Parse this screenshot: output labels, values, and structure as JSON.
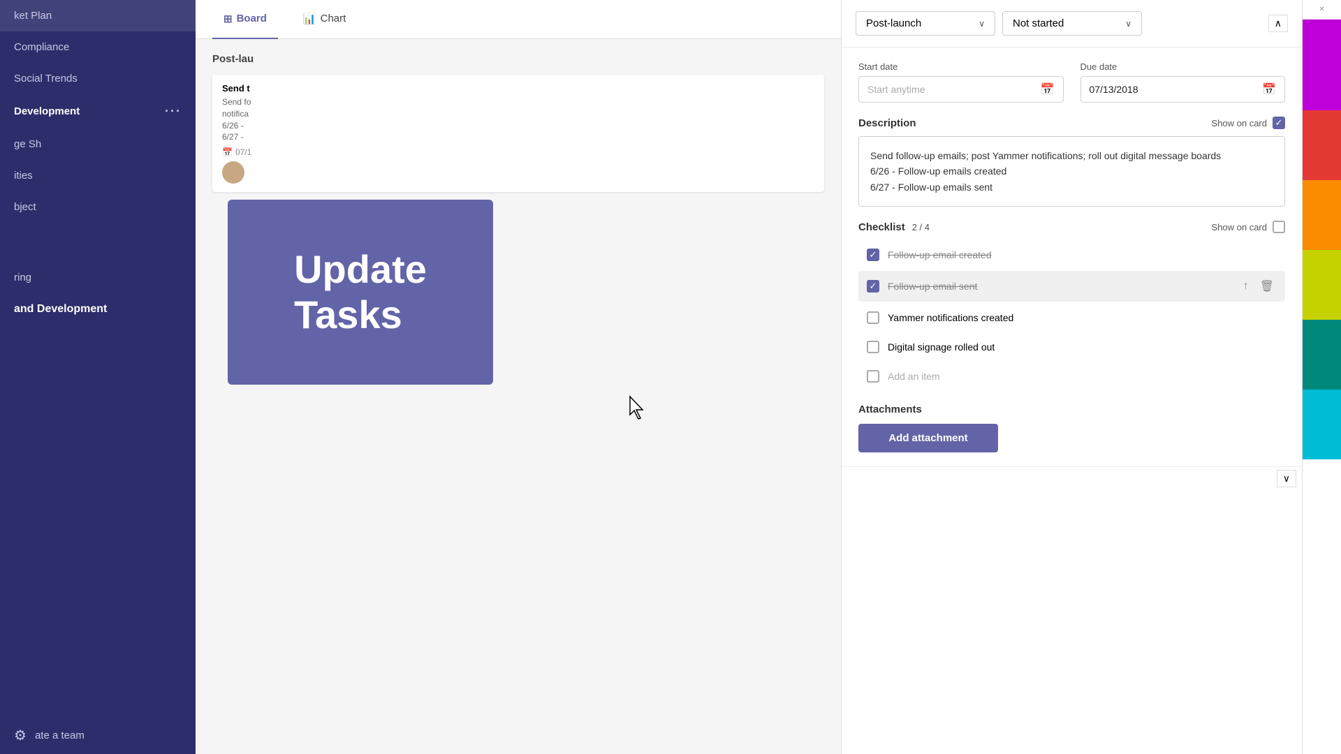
{
  "sidebar": {
    "items": [
      {
        "id": "market-plan",
        "label": "ket Plan",
        "active": false
      },
      {
        "id": "compliance",
        "label": "Compliance",
        "active": false
      },
      {
        "id": "social-trends",
        "label": "Social Trends",
        "active": false
      },
      {
        "id": "development",
        "label": "Development",
        "dots": "···",
        "active": true
      },
      {
        "id": "ge-sh",
        "label": "ge Sh",
        "active": false
      },
      {
        "id": "ities",
        "label": "ities",
        "active": false
      },
      {
        "id": "bject",
        "label": "bject",
        "active": false
      },
      {
        "id": "blank1",
        "label": "",
        "active": false
      },
      {
        "id": "blank2",
        "label": "",
        "active": false
      },
      {
        "id": "ring",
        "label": "ring",
        "active": false
      },
      {
        "id": "and-development",
        "label": "and Development",
        "bold": true,
        "active": false
      },
      {
        "id": "ate-a-team",
        "label": "ate a team",
        "active": false
      }
    ],
    "create_team_label": "ate a team",
    "gear_label": "⚙"
  },
  "tabs": [
    {
      "id": "board",
      "label": "Board",
      "icon": "⊞",
      "active": true
    },
    {
      "id": "chart",
      "label": "Chart",
      "icon": "📊",
      "active": false
    }
  ],
  "board": {
    "section_title": "Post-lau",
    "card": {
      "title": "Send t",
      "description": "Send fo\nnotifica\n6/26 -\n6/27 -",
      "date": "07/1"
    }
  },
  "overlay": {
    "line1": "Update",
    "line2": "Tasks"
  },
  "detail_panel": {
    "bucket_dropdown": "Post-launch",
    "status_dropdown": "Not started",
    "start_date_label": "Start date",
    "start_date_placeholder": "Start anytime",
    "due_date_label": "Due date",
    "due_date_value": "07/13/2018",
    "description_label": "Description",
    "show_on_card_label": "Show on card",
    "description_text": "Send follow-up emails; post Yammer notifications; roll out digital message boards\n6/26 - Follow-up emails created\n6/27 - Follow-up emails sent",
    "checklist_label": "Checklist",
    "checklist_count": "2 / 4",
    "checklist_items": [
      {
        "id": 1,
        "text": "Follow-up email created",
        "checked": true,
        "strikethrough": true
      },
      {
        "id": 2,
        "text": "Follow-up email sent",
        "checked": true,
        "strikethrough": true,
        "active": true
      },
      {
        "id": 3,
        "text": "Yammer notifications created",
        "checked": false,
        "strikethrough": false
      },
      {
        "id": 4,
        "text": "Digital signage rolled out",
        "checked": false,
        "strikethrough": false
      }
    ],
    "add_item_placeholder": "Add an item",
    "attachments_label": "Attachments",
    "add_attachment_btn": "Add attachment"
  },
  "colors": [
    {
      "id": "magenta",
      "value": "#e040fb"
    },
    {
      "id": "red-orange",
      "value": "#e53935"
    },
    {
      "id": "orange",
      "value": "#fb8c00"
    },
    {
      "id": "yellow-green",
      "value": "#c6d200"
    },
    {
      "id": "teal",
      "value": "#00897b"
    },
    {
      "id": "cyan",
      "value": "#00bcd4"
    }
  ],
  "icons": {
    "board": "⊞",
    "chart": "📊",
    "calendar": "📅",
    "up_arrow": "↑",
    "delete": "🗑",
    "chevron_down": "∨",
    "check": "✓",
    "scroll_up": "∧",
    "scroll_down": "∨"
  }
}
